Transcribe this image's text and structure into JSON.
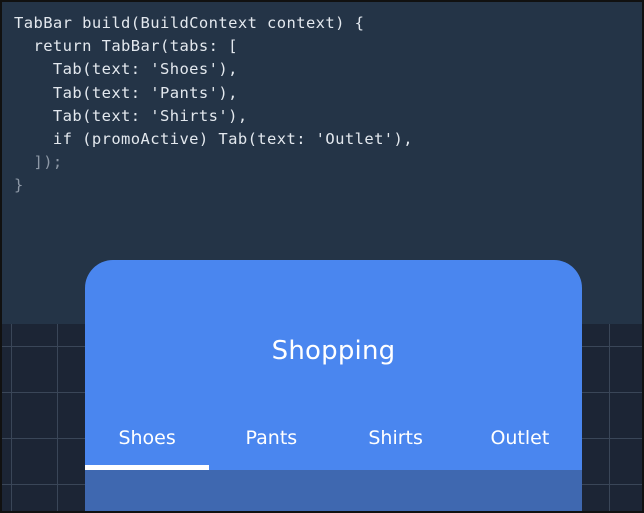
{
  "code": {
    "lines": [
      "TabBar build(BuildContext context) {",
      "  return TabBar(tabs: [",
      "    Tab(text: 'Shoes'),",
      "    Tab(text: 'Pants'),",
      "    Tab(text: 'Shirts'),",
      "    if (promoActive) Tab(text: 'Outlet'),",
      "  ]);",
      "}"
    ]
  },
  "app": {
    "title": "Shopping",
    "tabs": [
      {
        "label": "Shoes",
        "selected": true
      },
      {
        "label": "Pants",
        "selected": false
      },
      {
        "label": "Shirts",
        "selected": false
      },
      {
        "label": "Outlet",
        "selected": false
      }
    ]
  },
  "colors": {
    "code_background": "#243447",
    "grid_background": "#1c2535",
    "app_bar": "#4a86ef",
    "content": "#3f68b0",
    "indicator": "#ffffff"
  }
}
